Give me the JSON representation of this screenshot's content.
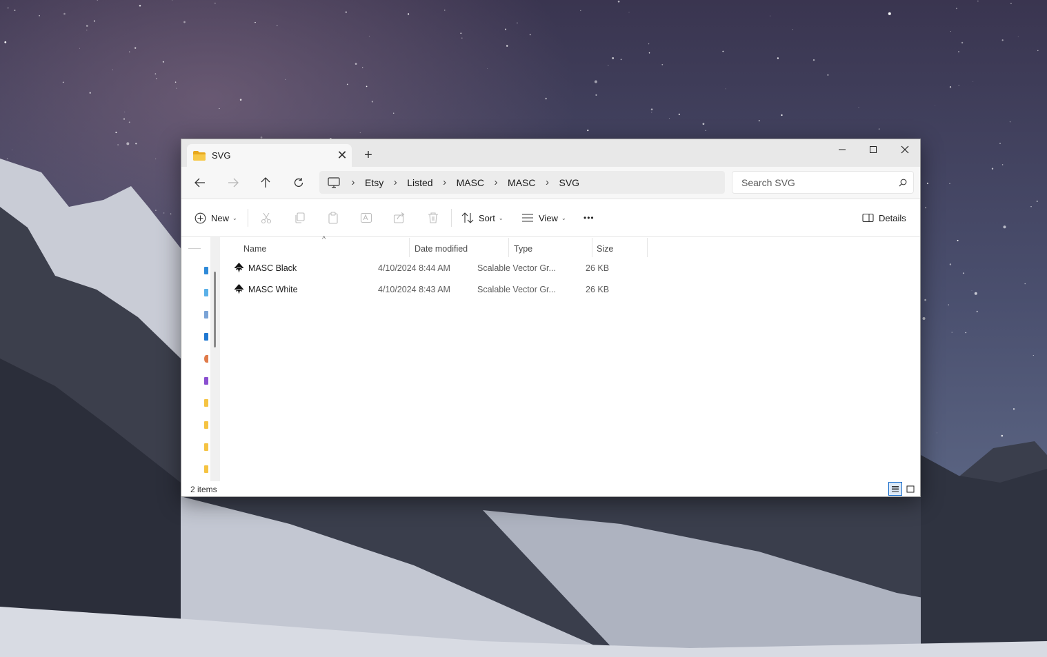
{
  "window": {
    "tab_title": "SVG",
    "new_tab_label": "+"
  },
  "breadcrumb": [
    "Etsy",
    "Listed",
    "MASC",
    "MASC",
    "SVG"
  ],
  "search": {
    "placeholder": "Search SVG"
  },
  "toolbar": {
    "new_label": "New",
    "sort_label": "Sort",
    "view_label": "View",
    "more_label": "•••",
    "details_label": "Details"
  },
  "columns": {
    "name": "Name",
    "date": "Date modified",
    "type": "Type",
    "size": "Size"
  },
  "files": [
    {
      "name": "MASC Black",
      "date": "4/10/2024 8:44 AM",
      "type": "Scalable Vector Gr...",
      "size": "26 KB"
    },
    {
      "name": "MASC White",
      "date": "4/10/2024 8:43 AM",
      "type": "Scalable Vector Gr...",
      "size": "26 KB"
    }
  ],
  "status": {
    "item_count": "2 items"
  },
  "colors": {
    "accent": "#0a64c8",
    "folder": "#f5c342",
    "titlebar": "#e8e8e8"
  }
}
